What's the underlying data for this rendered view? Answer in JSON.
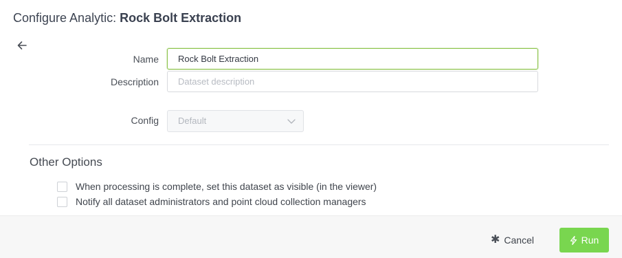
{
  "header": {
    "title_prefix": "Configure Analytic: ",
    "title_name": "Rock Bolt Extraction"
  },
  "form": {
    "name_label": "Name",
    "name_value": "Rock Bolt Extraction",
    "description_label": "Description",
    "description_placeholder": "Dataset description",
    "config_label": "Config",
    "config_value": "Default"
  },
  "options": {
    "title": "Other Options",
    "items": [
      {
        "label": "When processing is complete, set this dataset as visible (in the viewer)",
        "checked": false
      },
      {
        "label": "Notify all dataset administrators and point cloud collection managers",
        "checked": false
      }
    ]
  },
  "footer": {
    "cancel_label": "Cancel",
    "run_label": "Run"
  },
  "colors": {
    "accent": "#79d64f",
    "focus_border": "#8bc34a",
    "footer_bg": "#f7f7f7"
  },
  "icons": {
    "back": "arrow-left-icon",
    "cancel": "asterisk-icon",
    "run": "lightning-icon",
    "select": "chevron-down-icon"
  }
}
